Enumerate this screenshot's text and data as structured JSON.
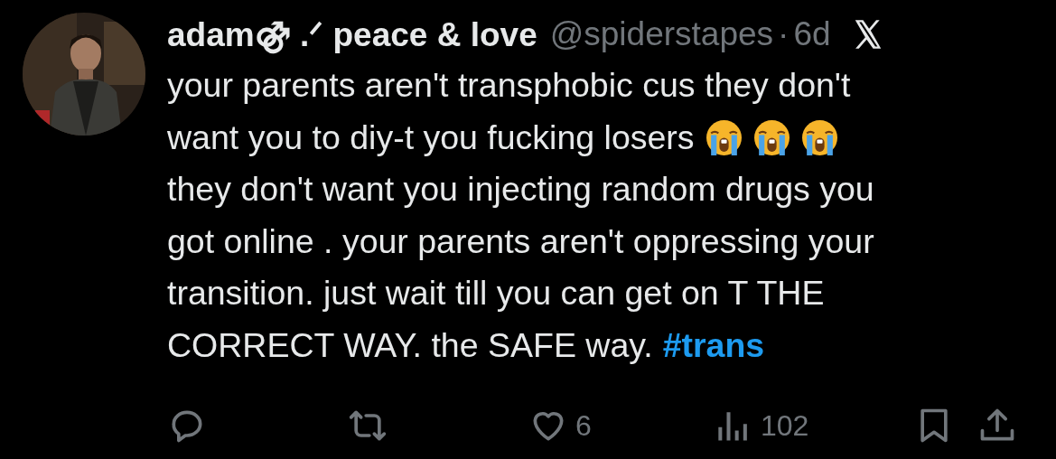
{
  "tweet": {
    "author": {
      "name": "adam⚣ .ᐟ peace & love",
      "handle": "@spiderstapes",
      "separator": "·",
      "time": "6d"
    },
    "lines": [
      [
        {
          "kind": "text",
          "text": "your parents aren't transphobic cus they don't"
        }
      ],
      [
        {
          "kind": "text",
          "text": "want you to diy-t you fucking losers"
        },
        {
          "kind": "emoji"
        },
        {
          "kind": "emoji"
        },
        {
          "kind": "emoji"
        }
      ],
      [
        {
          "kind": "text",
          "text": "they don't want you injecting random drugs you"
        }
      ],
      [
        {
          "kind": "text",
          "text": "got online . your parents aren't oppressing your"
        }
      ],
      [
        {
          "kind": "text",
          "text": "transition. just wait till you can get on T THE"
        }
      ],
      [
        {
          "kind": "text",
          "text": "CORRECT WAY. the SAFE way."
        },
        {
          "kind": "hashtag",
          "text": "#trans"
        }
      ]
    ],
    "actions": [
      {
        "kind": "reply"
      },
      {
        "kind": "repost"
      },
      {
        "kind": "like",
        "count": "6"
      },
      {
        "kind": "views",
        "count": "102"
      },
      {
        "kind": "bookmark"
      },
      {
        "kind": "share"
      }
    ]
  }
}
